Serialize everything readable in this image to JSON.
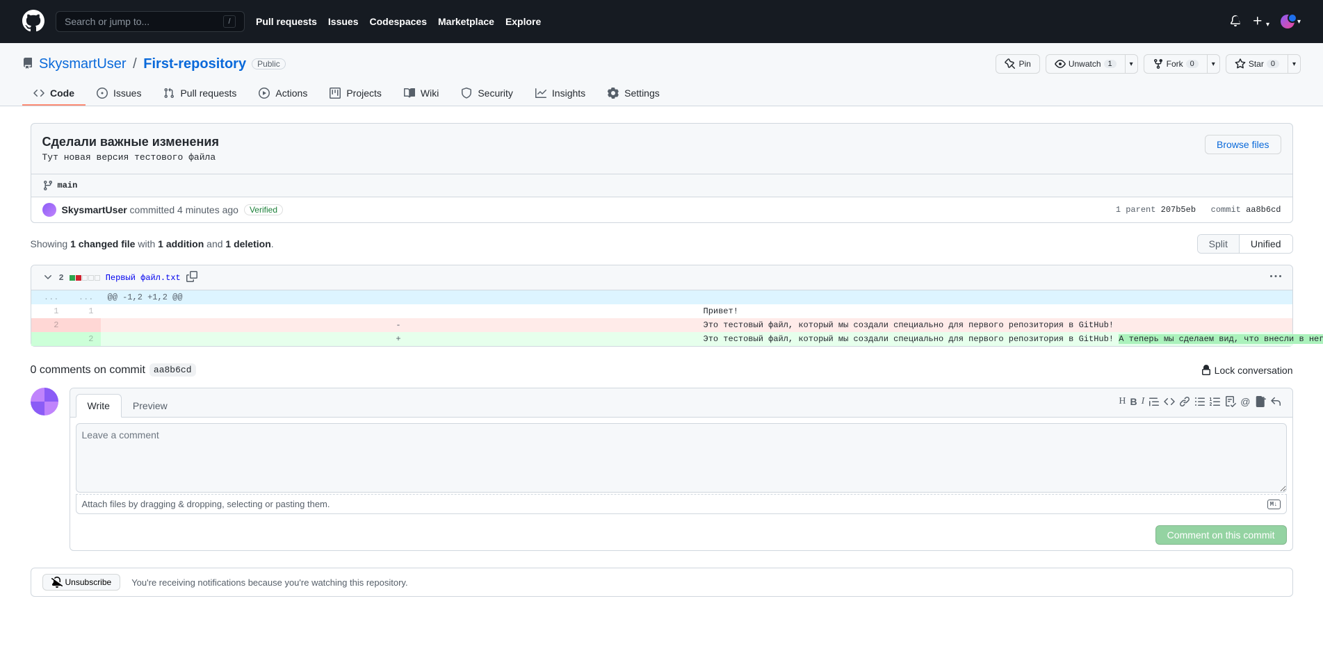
{
  "header": {
    "search_placeholder": "Search or jump to...",
    "nav": {
      "pulls": "Pull requests",
      "issues": "Issues",
      "codespaces": "Codespaces",
      "marketplace": "Marketplace",
      "explore": "Explore"
    }
  },
  "repo": {
    "owner": "SkysmartUser",
    "name": "First-repository",
    "visibility": "Public",
    "actions": {
      "pin": "Pin",
      "unwatch": "Unwatch",
      "watch_count": "1",
      "fork": "Fork",
      "fork_count": "0",
      "star": "Star",
      "star_count": "0"
    },
    "nav": {
      "code": "Code",
      "issues": "Issues",
      "pulls": "Pull requests",
      "actions": "Actions",
      "projects": "Projects",
      "wiki": "Wiki",
      "security": "Security",
      "insights": "Insights",
      "settings": "Settings"
    }
  },
  "commit": {
    "title": "Сделали важные изменения",
    "description": "Тут новая версия тестового файла",
    "browse_files": "Browse files",
    "branch": "main",
    "author": "SkysmartUser",
    "time_text": " committed 4 minutes ago",
    "verified": "Verified",
    "parent_label": "1 parent ",
    "parent_sha": "207b5eb",
    "commit_label": "commit ",
    "sha": "aa8b6cd"
  },
  "diff_stats": {
    "showing": "Showing ",
    "files": "1 changed file",
    "with": " with ",
    "additions": "1 addition",
    "and": " and ",
    "deletions": "1 deletion",
    "split": "Split",
    "unified": "Unified"
  },
  "file": {
    "changes": "2",
    "name": "Первый файл.txt",
    "hunk": "@@ -1,2 +1,2 @@",
    "line1_old": "1",
    "line1_new": "1",
    "line1_text": "Привет!",
    "line2_old": "2",
    "line2_text": "Это тестовый файл, который мы создали специально для первого репозитория в GitHub!",
    "line3_new": "2",
    "line3_text_base": "Это тестовый файл, который мы создали специально для первого репозитория в GitHub! ",
    "line3_text_added": "А теперь мы сделаем вид, что внесли в него важные изменения, чтобы показать, как работают коммиты."
  },
  "comments": {
    "header": "0 comments on commit ",
    "sha": "aa8b6cd",
    "lock": "Lock conversation",
    "write_tab": "Write",
    "preview_tab": "Preview",
    "placeholder": "Leave a comment",
    "attach": "Attach files by dragging & dropping, selecting or pasting them.",
    "submit": "Comment on this commit"
  },
  "subscribe": {
    "button": "Unsubscribe",
    "text": "You're receiving notifications because you're watching this repository."
  }
}
